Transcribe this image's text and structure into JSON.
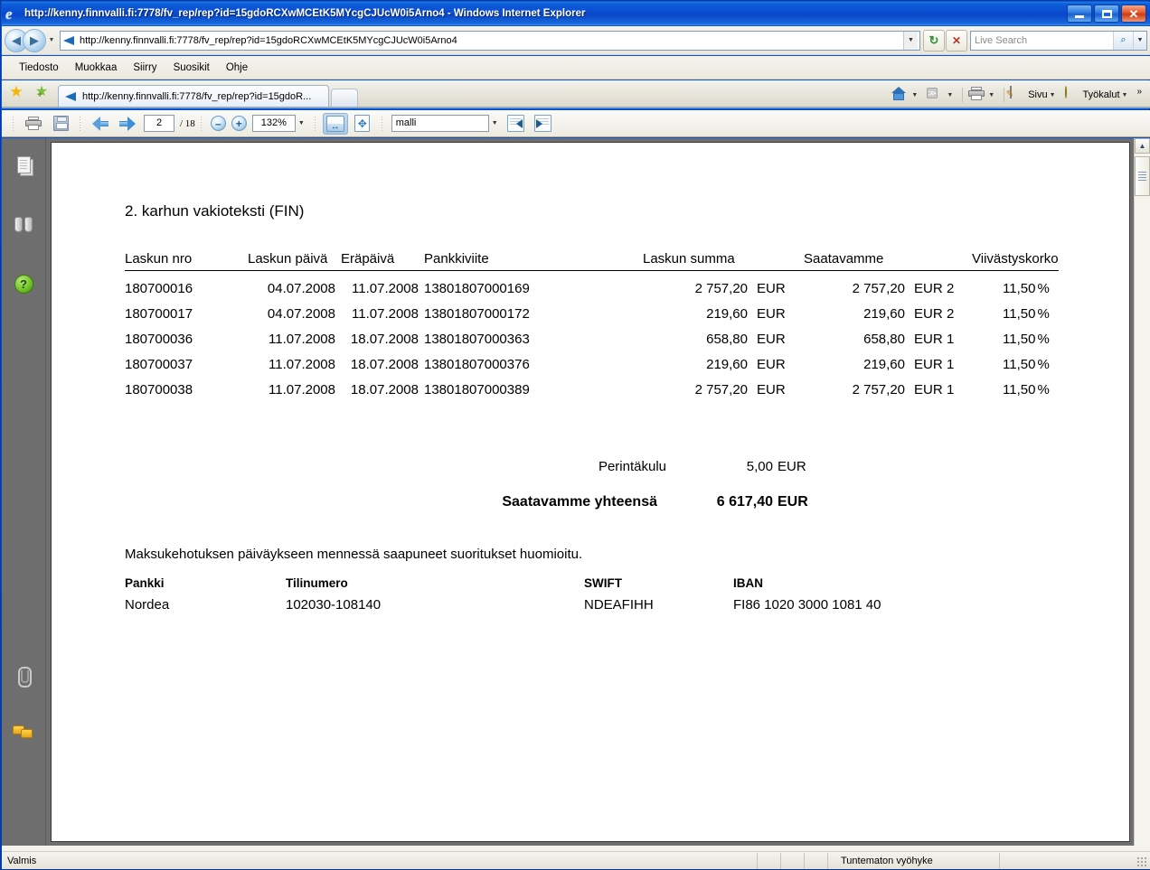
{
  "window": {
    "title": "http://kenny.finnvalli.fi:7778/fv_rep/rep?id=15gdoRCXwMCEtK5MYcgCJUcW0i5Arno4 - Windows Internet Explorer",
    "minimize_label": "",
    "maximize_label": "",
    "close_label": "✕"
  },
  "address_bar": {
    "url": "http://kenny.finnvalli.fi:7778/fv_rep/rep?id=15gdoRCXwMCEtK5MYcgCJUcW0i5Arno4",
    "back_glyph": "◀",
    "forward_glyph": "▶",
    "refresh_glyph": "↻",
    "stop_glyph": "✕",
    "dropdown_glyph": "▼"
  },
  "search": {
    "placeholder": "Live Search",
    "go_glyph": "🔍",
    "dropdown_glyph": "▼"
  },
  "menu": {
    "items": [
      {
        "label": "Tiedosto"
      },
      {
        "label": "Muokkaa"
      },
      {
        "label": "Siirry"
      },
      {
        "label": "Suosikit"
      },
      {
        "label": "Ohje"
      }
    ]
  },
  "tabs": {
    "active_label": "http://kenny.finnvalli.fi:7778/fv_rep/rep?id=15gdoR...",
    "new_tab_label": ""
  },
  "command_bar": {
    "home_label": "",
    "feeds_label": "",
    "print_label": "",
    "page_label": "Sivu",
    "tools_label": "Työkalut",
    "overflow_label": "»",
    "caret": "▼"
  },
  "pdf_toolbar": {
    "print_label": "",
    "save_label": "",
    "prev_page_label": "",
    "next_page_label": "",
    "page_number": "2",
    "page_total": "/ 18",
    "zoom_out_label": "–",
    "zoom_in_label": "+",
    "zoom_value": "132%",
    "zoom_caret": "▼",
    "fit_width_label": "",
    "fit_page_label": "",
    "model_value": "malli",
    "model_caret": "▼",
    "prev_doc_label": "",
    "next_doc_label": ""
  },
  "sidebar": {
    "items": [
      {
        "name": "pages-panel",
        "icon": "pages-icon"
      },
      {
        "name": "search-panel",
        "icon": "binoculars-icon"
      },
      {
        "name": "help-panel",
        "icon": "help-icon"
      },
      {
        "name": "attachments-panel",
        "icon": "paperclip-icon"
      },
      {
        "name": "comments-panel",
        "icon": "comments-icon"
      }
    ]
  },
  "document": {
    "title": "2. karhun vakioteksti (FIN)",
    "table": {
      "headers": {
        "invoice_no": "Laskun nro",
        "invoice_date": "Laskun päivä",
        "due_date": "Eräpäivä",
        "bank_reference": "Pankkiviite",
        "invoice_sum": "Laskun summa",
        "receivable": "Saatavamme",
        "interest": "Viivästyskorko"
      },
      "rows": [
        {
          "invoice_no": "180700016",
          "invoice_date": "04.07.2008",
          "due_date": "11.07.2008",
          "bank_reference": "13801807000169",
          "invoice_sum": "2 757,20",
          "invoice_currency": "EUR",
          "receivable": "2 757,20",
          "receivable_currency": "EUR",
          "reminder_count": "2",
          "interest_rate": "11,50",
          "percent": "%"
        },
        {
          "invoice_no": "180700017",
          "invoice_date": "04.07.2008",
          "due_date": "11.07.2008",
          "bank_reference": "13801807000172",
          "invoice_sum": "219,60",
          "invoice_currency": "EUR",
          "receivable": "219,60",
          "receivable_currency": "EUR",
          "reminder_count": "2",
          "interest_rate": "11,50",
          "percent": "%"
        },
        {
          "invoice_no": "180700036",
          "invoice_date": "11.07.2008",
          "due_date": "18.07.2008",
          "bank_reference": "13801807000363",
          "invoice_sum": "658,80",
          "invoice_currency": "EUR",
          "receivable": "658,80",
          "receivable_currency": "EUR",
          "reminder_count": "1",
          "interest_rate": "11,50",
          "percent": "%"
        },
        {
          "invoice_no": "180700037",
          "invoice_date": "11.07.2008",
          "due_date": "18.07.2008",
          "bank_reference": "13801807000376",
          "invoice_sum": "219,60",
          "invoice_currency": "EUR",
          "receivable": "219,60",
          "receivable_currency": "EUR",
          "reminder_count": "1",
          "interest_rate": "11,50",
          "percent": "%"
        },
        {
          "invoice_no": "180700038",
          "invoice_date": "11.07.2008",
          "due_date": "18.07.2008",
          "bank_reference": "13801807000389",
          "invoice_sum": "2 757,20",
          "invoice_currency": "EUR",
          "receivable": "2 757,20",
          "receivable_currency": "EUR",
          "reminder_count": "1",
          "interest_rate": "11,50",
          "percent": "%"
        }
      ]
    },
    "totals": {
      "fee_label": "Perintäkulu",
      "fee_value": "5,00",
      "fee_currency": "EUR",
      "total_label": "Saatavamme yhteensä",
      "total_value": "6 617,40",
      "total_currency": "EUR"
    },
    "note": "Maksukehotuksen päiväykseen mennessä saapuneet suoritukset huomioitu.",
    "bank": {
      "headers": {
        "bank": "Pankki",
        "account": "Tilinumero",
        "swift": "SWIFT",
        "iban": "IBAN"
      },
      "row": {
        "bank": "Nordea",
        "account": "102030-108140",
        "swift": "NDEAFIHH",
        "iban": "FI86 1020 3000 1081 40"
      }
    }
  },
  "scrollbar": {
    "up_glyph": "▲",
    "down_glyph": "▼"
  },
  "status_bar": {
    "left_text": "Valmis",
    "zone_text": "Tuntematon vyöhyke"
  },
  "colors": {
    "title_blue": "#0a46c8",
    "chrome_beige": "#ece9de",
    "viewer_gray": "#6e6e6e",
    "paper_white": "#ffffff",
    "accent_green": "#74c62c",
    "close_red": "#e4552a"
  }
}
